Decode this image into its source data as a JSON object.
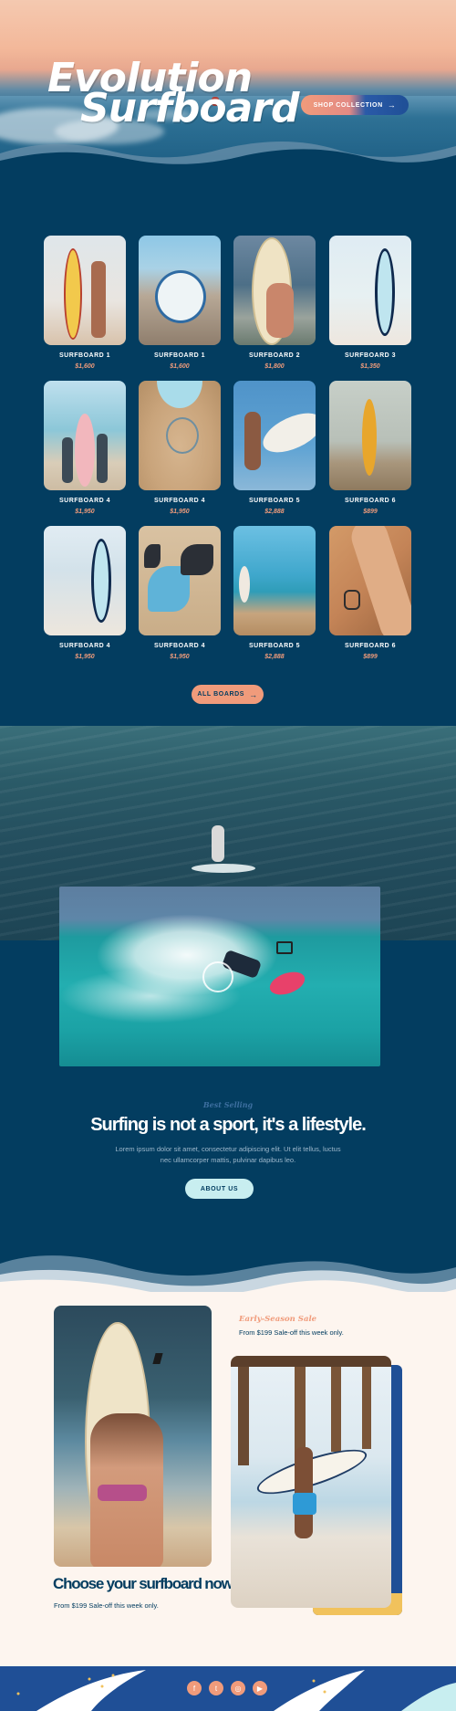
{
  "hero": {
    "title_line1": "Evolution",
    "title_line2": "Surfboard",
    "cta_label": "SHOP COLLECTION",
    "cta_arrow": "→"
  },
  "products": [
    {
      "name": "SURFBOARD 1",
      "price": "$1,600"
    },
    {
      "name": "SURFBOARD 1",
      "price": "$1,600"
    },
    {
      "name": "SURFBOARD 2",
      "price": "$1,800"
    },
    {
      "name": "SURFBOARD 3",
      "price": "$1,350"
    },
    {
      "name": "SURFBOARD 4",
      "price": "$1,950"
    },
    {
      "name": "SURFBOARD 4",
      "price": "$1,950"
    },
    {
      "name": "SURFBOARD 5",
      "price": "$2,888"
    },
    {
      "name": "SURFBOARD 6",
      "price": "$899"
    },
    {
      "name": "SURFBOARD 4",
      "price": "$1,950"
    },
    {
      "name": "SURFBOARD 4",
      "price": "$1,950"
    },
    {
      "name": "SURFBOARD 5",
      "price": "$2,888"
    },
    {
      "name": "SURFBOARD 6",
      "price": "$899"
    }
  ],
  "all_boards": {
    "label": "ALL BOARDS",
    "arrow": "→"
  },
  "about": {
    "eyebrow": "Best Selling",
    "heading": "Surfing is not a sport, it's a lifestyle.",
    "body_line1": "Lorem ipsum dolor sit amet, consectetur adipiscing elit. Ut elit tellus, luctus",
    "body_line2": "nec ullamcorper mattis, pulvinar dapibus leo.",
    "button": "ABOUT US"
  },
  "promo": {
    "eyebrow": "Early-Season Sale",
    "right_text": "From $199 Sale-off this week only.",
    "heading": "Choose your surfboard now!",
    "left_text": "From $199 Sale-off this week only."
  },
  "footer": {
    "icons": [
      "facebook-icon",
      "twitter-icon",
      "instagram-icon",
      "youtube-icon"
    ],
    "glyphs": [
      "f",
      "t",
      "◎",
      "▶"
    ]
  },
  "colors": {
    "navy": "#033d60",
    "peach": "#f09b7b",
    "mint": "#c8eef0",
    "cream": "#fdf5ef",
    "blue": "#1f4f96"
  }
}
